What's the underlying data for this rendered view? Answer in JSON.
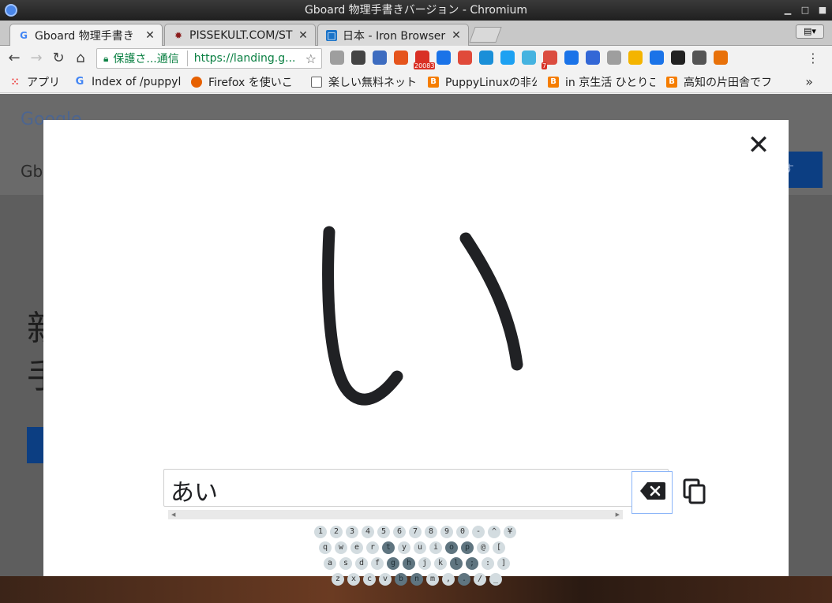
{
  "window": {
    "title": "Gboard 物理手書きバージョン - Chromium"
  },
  "tabs": [
    {
      "label": "Gboard 物理手書き",
      "icon": "google-g-icon",
      "active": true
    },
    {
      "label": "PISSEKULT.COM/ST",
      "icon": "pissekult-icon",
      "active": false
    },
    {
      "label": "日本 - Iron Browser",
      "icon": "iron-browser-icon",
      "active": false
    }
  ],
  "toolbar": {
    "secure_label": "保護さ...通信",
    "url": "https://landing.g..."
  },
  "extensions": [
    {
      "name": "grey-circle-icon",
      "color": "#9e9e9e"
    },
    {
      "name": "globe-dark-icon",
      "color": "#444444"
    },
    {
      "name": "globe-blue-icon",
      "color": "#3d6cc0"
    },
    {
      "name": "office-icon",
      "color": "#e5541c"
    },
    {
      "name": "gmail-icon",
      "color": "#d93025",
      "badge": "20083"
    },
    {
      "name": "chat-icon",
      "color": "#1a73e8"
    },
    {
      "name": "target-icon",
      "color": "#e04a3a"
    },
    {
      "name": "e-icon",
      "color": "#1a8fd8"
    },
    {
      "name": "twitter-icon",
      "color": "#1da1f2"
    },
    {
      "name": "message-icon",
      "color": "#45b3e0"
    },
    {
      "name": "todoist-icon",
      "color": "#db4c3f",
      "badge": "7"
    },
    {
      "name": "news-icon",
      "color": "#1a73e8"
    },
    {
      "name": "calendar-icon",
      "color": "#3367d6"
    },
    {
      "name": "grey-globe-icon",
      "color": "#9e9e9e"
    },
    {
      "name": "edit-icon",
      "color": "#f4b400"
    },
    {
      "name": "wifi-icon",
      "color": "#1a73e8"
    },
    {
      "name": "screen-icon",
      "color": "#222222"
    },
    {
      "name": "evernote-icon",
      "color": "#555555"
    },
    {
      "name": "fox-icon",
      "color": "#e8710a"
    }
  ],
  "bookmarks": [
    {
      "label": "アプリ",
      "icon": "apps-grid-icon"
    },
    {
      "label": "Index of /puppyli",
      "icon": "google-g-icon"
    },
    {
      "label": "Firefox を使いこ",
      "icon": "firefox-icon"
    },
    {
      "label": "楽しい無料ネット",
      "icon": "page-icon"
    },
    {
      "label": "PuppyLinuxの非公",
      "icon": "blogger-icon"
    },
    {
      "label": "in 京生活 ひとりご",
      "icon": "blogger-icon"
    },
    {
      "label": "高知の片田舎でフ",
      "icon": "blogger-icon"
    }
  ],
  "background": {
    "logo": "Google",
    "header_text": "Gb",
    "blue_button": "す",
    "big_lines": [
      "新",
      "手"
    ]
  },
  "handwriting": {
    "glyph": "い",
    "input_text": "あい"
  },
  "keyboard": {
    "rows": [
      [
        "1",
        "2",
        "3",
        "4",
        "5",
        "6",
        "7",
        "8",
        "9",
        "0",
        "-",
        "^",
        "¥"
      ],
      [
        "q",
        "w",
        "e",
        "r",
        "t",
        "y",
        "u",
        "i",
        "o",
        "p",
        "@",
        "["
      ],
      [
        "a",
        "s",
        "d",
        "f",
        "g",
        "h",
        "j",
        "k",
        "l",
        ";",
        ":",
        "]"
      ],
      [
        "z",
        "x",
        "c",
        "v",
        "b",
        "n",
        "m",
        ",",
        ".",
        "/",
        "_"
      ]
    ],
    "dark_keys": [
      "t",
      "o",
      "p",
      "g",
      "h",
      "l",
      ";",
      "b",
      "n",
      "."
    ]
  }
}
